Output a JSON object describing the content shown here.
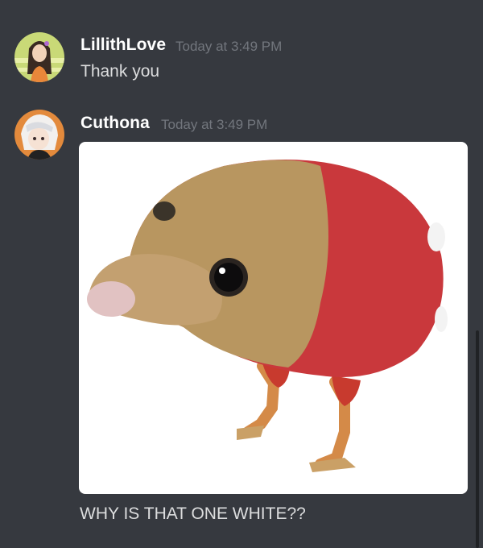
{
  "messages": [
    {
      "username": "LillithLove",
      "timestamp": "Today at 3:49 PM",
      "text": "Thank you"
    },
    {
      "username": "Cuthona",
      "timestamp": "Today at 3:49 PM",
      "attachment_icon": "image-attachment",
      "text": "WHY IS THAT ONE WHITE??"
    }
  ],
  "colors": {
    "background": "#36393f",
    "username": "#ffffff",
    "timestamp": "#72767d",
    "message_text": "#dcddde"
  }
}
